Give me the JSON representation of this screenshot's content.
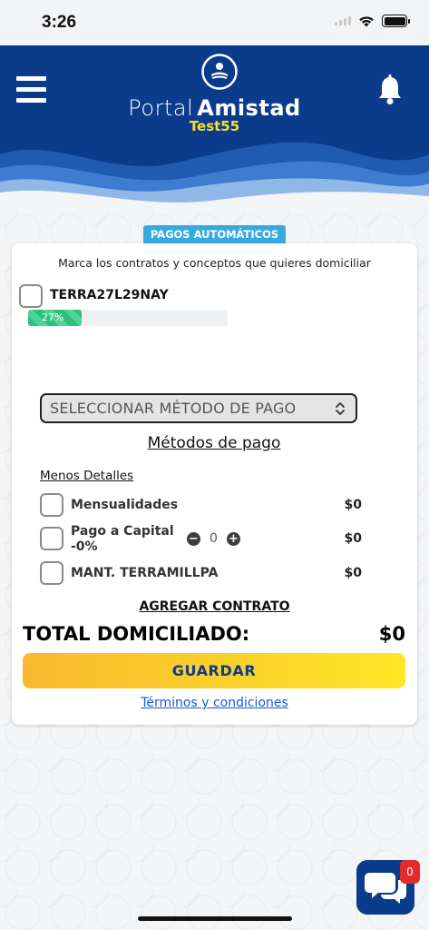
{
  "status_bar": {
    "time": "3:26"
  },
  "header": {
    "brand_light": "Portal",
    "brand_bold": "Amistad",
    "subtitle": "Test55",
    "menu_icon": "hamburger-menu-icon",
    "bell_icon": "bell-icon",
    "colors": {
      "header_bg": "#0b3c8c",
      "subtitle": "#f7e02a"
    }
  },
  "section_tag": "PAGOS AUTOMÁTICOS",
  "card": {
    "instructions": "Marca los contratos y conceptos que quieres domiciliar",
    "contract": {
      "code": "TERRA27L29NAY",
      "progress_label": "27%",
      "progress_value": 0.27
    },
    "payment_select": {
      "placeholder": "SELECCIONAR MÉTODO DE PAGO"
    },
    "methods_link": "Métodos de pago",
    "less_details": "Menos Detalles",
    "concepts": [
      {
        "label": "Mensualidades",
        "amount": "$0"
      },
      {
        "label_line1": "Pago a Capital",
        "label_line2": "-0%",
        "amount": "$0",
        "stepper_value": "0"
      },
      {
        "label": "MANT. TERRAMILLPA",
        "amount": "$0"
      }
    ],
    "add_contract": "AGREGAR CONTRATO",
    "total_label": "TOTAL DOMICILIADO:",
    "total_value": "$0",
    "save_button": "GUARDAR",
    "terms": "Términos y condiciones"
  },
  "chat": {
    "badge_count": "0",
    "icon": "chat-bubbles-icon"
  }
}
